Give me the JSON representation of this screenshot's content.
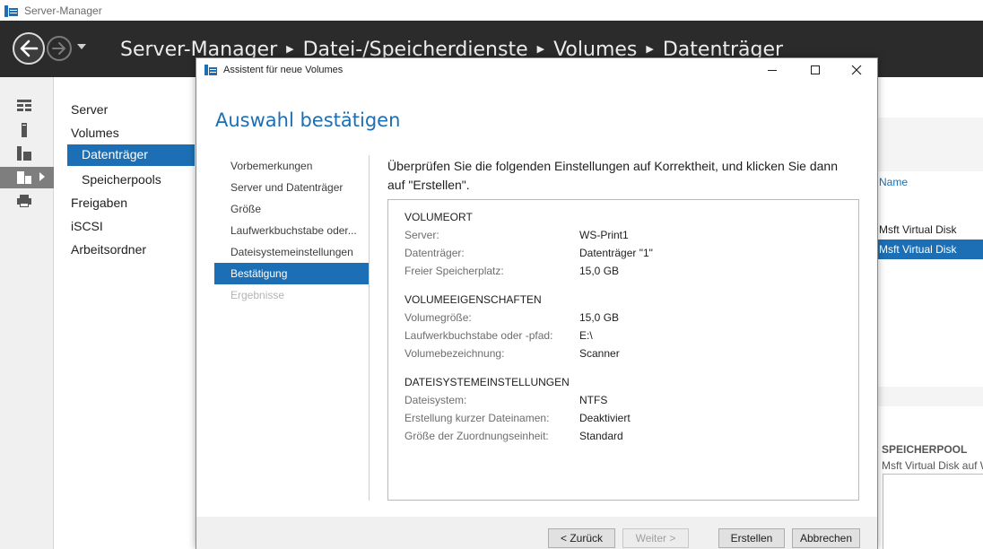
{
  "app": {
    "title": "Server-Manager",
    "icon": "server-manager-icon"
  },
  "header": {
    "breadcrumb": [
      "Server-Manager",
      "Datei-/Speicherdienste",
      "Volumes",
      "Datenträger"
    ]
  },
  "navtree": {
    "items": [
      {
        "label": "Server"
      },
      {
        "label": "Volumes"
      },
      {
        "label": "Datenträger",
        "selected": true
      },
      {
        "label": "Speicherpools"
      },
      {
        "label": "Freigaben"
      },
      {
        "label": "iSCSI"
      },
      {
        "label": "Arbeitsordner"
      }
    ]
  },
  "rightpane": {
    "column_name": "Name",
    "rows": [
      "Msft Virtual Disk",
      "Msft Virtual Disk"
    ],
    "storagepool_title": "SPEICHERPOOL",
    "storagepool_sub": "Msft Virtual Disk auf W"
  },
  "dialog": {
    "title": "Assistent für neue Volumes",
    "heading": "Auswahl bestätigen",
    "steps": [
      {
        "label": "Vorbemerkungen",
        "state": "normal"
      },
      {
        "label": "Server und Datenträger",
        "state": "normal"
      },
      {
        "label": "Größe",
        "state": "normal"
      },
      {
        "label": "Laufwerkbuchstabe oder...",
        "state": "normal"
      },
      {
        "label": "Dateisystemeinstellungen",
        "state": "normal"
      },
      {
        "label": "Bestätigung",
        "state": "active"
      },
      {
        "label": "Ergebnisse",
        "state": "disabled"
      }
    ],
    "intro": "Überprüfen Sie die folgenden Einstellungen auf Korrektheit, und klicken Sie dann auf \"Erstellen\".",
    "sections": [
      {
        "title": "VOLUMEORT",
        "rows": [
          {
            "label": "Server:",
            "value": "WS-Print1"
          },
          {
            "label": "Datenträger:",
            "value": "Datenträger \"1\""
          },
          {
            "label": "Freier Speicherplatz:",
            "value": "15,0 GB"
          }
        ]
      },
      {
        "title": "VOLUMEEIGENSCHAFTEN",
        "rows": [
          {
            "label": "Volumegröße:",
            "value": "15,0 GB"
          },
          {
            "label": "Laufwerkbuchstabe oder -pfad:",
            "value": "E:\\"
          },
          {
            "label": "Volumebezeichnung:",
            "value": "Scanner"
          }
        ]
      },
      {
        "title": "DATEISYSTEMEINSTELLUNGEN",
        "rows": [
          {
            "label": "Dateisystem:",
            "value": "NTFS"
          },
          {
            "label": "Erstellung kurzer Dateinamen:",
            "value": "Deaktiviert"
          },
          {
            "label": "Größe der Zuordnungseinheit:",
            "value": "Standard"
          }
        ]
      }
    ],
    "buttons": {
      "back": "< Zurück",
      "next": "Weiter >",
      "create": "Erstellen",
      "cancel": "Abbrechen"
    }
  },
  "colors": {
    "accent": "#1c6fb4",
    "header_bg": "#2b2b2b"
  }
}
